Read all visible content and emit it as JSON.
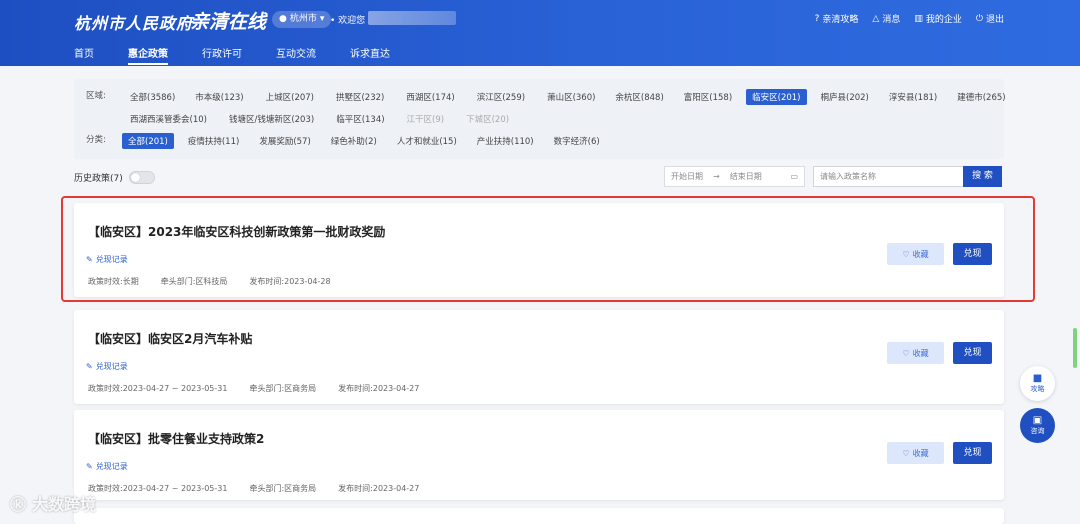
{
  "header": {
    "brand": "杭州市人民政府",
    "slogan": "亲清在线",
    "city": "杭州市",
    "welcome": "欢迎您",
    "links": [
      "亲清攻略",
      "消息",
      "我的企业",
      "退出"
    ]
  },
  "nav": [
    "首页",
    "惠企政策",
    "行政许可",
    "互动交流",
    "诉求直达"
  ],
  "filter": {
    "region_label": "区域:",
    "regions_row1": [
      "全部(3586)",
      "市本级(123)",
      "上城区(207)",
      "拱墅区(232)",
      "西湖区(174)",
      "滨江区(259)",
      "萧山区(360)",
      "余杭区(848)",
      "富阳区(158)",
      "临安区(201)",
      "桐庐县(202)",
      "淳安县(181)",
      "建德市(265)"
    ],
    "regions_row2": [
      "西湖西溪管委会(10)",
      "钱塘区/钱塘新区(203)",
      "临平区(134)",
      "江干区(9)",
      "下城区(20)"
    ],
    "category_label": "分类:",
    "categories": [
      "全部(201)",
      "疫情扶持(11)",
      "发展奖励(57)",
      "绿色补助(2)",
      "人才和就业(15)",
      "产业扶持(110)",
      "数字经济(6)"
    ]
  },
  "toolbar": {
    "history": "历史政策(7)",
    "start_date": "开始日期",
    "end_date": "结束日期",
    "search_placeholder": "请输入政策名称",
    "search_btn": "搜 索"
  },
  "cards": [
    {
      "title": "【临安区】2023年临安区科技创新政策第一批财政奖励",
      "record": "兑现记录",
      "validity": "政策时效:长期",
      "dept": "牵头部门:区科技局",
      "date": "发布时间:2023-04-28",
      "fav": "收藏",
      "redeem": "兑现"
    },
    {
      "title": "【临安区】临安区2月汽车补贴",
      "record": "兑现记录",
      "validity": "政策时效:2023-04-27 ~ 2023-05-31",
      "dept": "牵头部门:区商务局",
      "date": "发布时间:2023-04-27",
      "fav": "收藏",
      "redeem": "兑现"
    },
    {
      "title": "【临安区】批零住餐业支持政策2",
      "record": "兑现记录",
      "validity": "政策时效:2023-04-27 ~ 2023-05-31",
      "dept": "牵头部门:区商务局",
      "date": "发布时间:2023-04-27",
      "fav": "收藏",
      "redeem": "兑现"
    }
  ],
  "float": {
    "guide": "攻略",
    "consult": "咨询"
  },
  "watermark": "大数跨境",
  "colors": {
    "primary": "#1f4fc0",
    "highlight": "#e53935"
  }
}
